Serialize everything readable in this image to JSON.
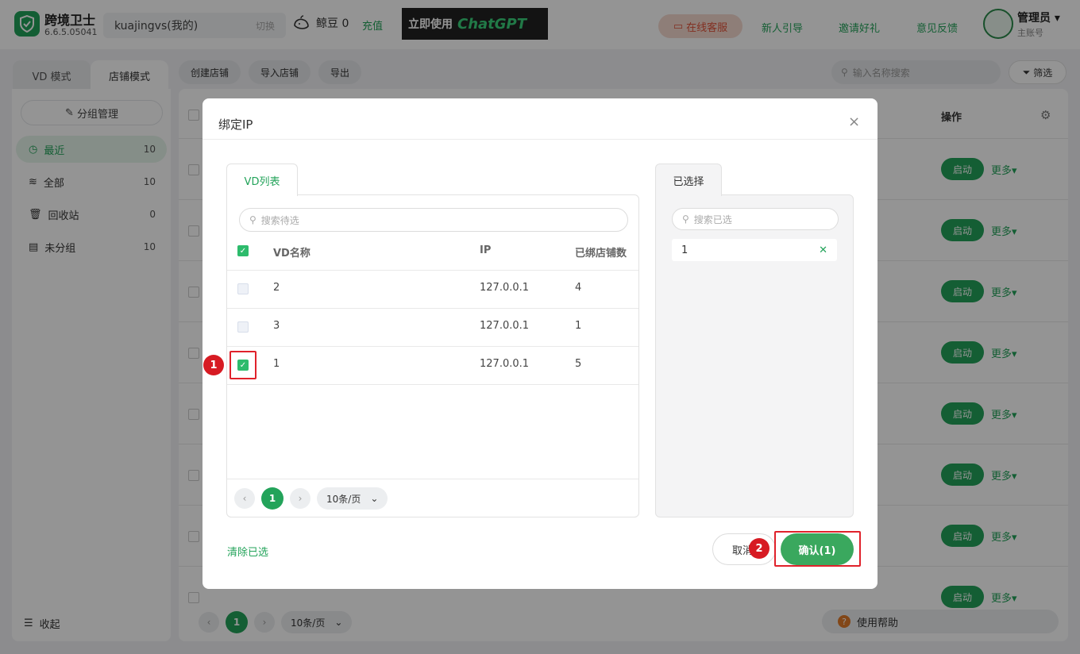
{
  "app": {
    "name": "跨境卫士",
    "version": "6.6.5.05041"
  },
  "topbar": {
    "account_name": "kuajingvs(我的)",
    "switch_label": "切换",
    "bean_label": "鲸豆 0",
    "recharge_label": "充值",
    "banner_text_1": "立即使用",
    "banner_text_2": "ChatGPT",
    "service_label": "在线客服",
    "links": [
      "新人引导",
      "邀请好礼",
      "意见反馈"
    ],
    "user_name": "管理员",
    "user_role": "主账号"
  },
  "sidebar": {
    "mode_tabs": [
      "VD 模式",
      "店铺模式"
    ],
    "active_mode": "店铺模式",
    "group_manage_label": "分组管理",
    "items": [
      {
        "label": "最近",
        "count": "10"
      },
      {
        "label": "全部",
        "count": "10"
      },
      {
        "label": "回收站",
        "count": "0"
      },
      {
        "label": "未分组",
        "count": "10"
      }
    ],
    "collapse_label": "收起"
  },
  "toolbar": {
    "create_label": "创建店铺",
    "import_label": "导入店铺",
    "export_label": "导出",
    "search_placeholder": "输入名称搜索",
    "filter_label": "筛选"
  },
  "table": {
    "op_header": "操作",
    "start_label": "启动",
    "more_label": "更多"
  },
  "bottom_pager": {
    "page": "1",
    "page_size": "10条/页"
  },
  "help_label": "使用帮助",
  "modal": {
    "title": "绑定IP",
    "left_tab": "VD列表",
    "left_search_placeholder": "搜索待选",
    "columns": [
      "VD名称",
      "IP",
      "已绑店铺数"
    ],
    "rows": [
      {
        "name": "2",
        "ip": "127.0.0.1",
        "count": "4",
        "checked": false
      },
      {
        "name": "3",
        "ip": "127.0.0.1",
        "count": "1",
        "checked": false
      },
      {
        "name": "1",
        "ip": "127.0.0.1",
        "count": "5",
        "checked": true
      }
    ],
    "pager": {
      "page": "1",
      "page_size": "10条/页"
    },
    "right_tab": "已选择",
    "right_search_placeholder": "搜索已选",
    "selected": [
      "1"
    ],
    "clear_label": "清除已选",
    "cancel_label": "取消",
    "confirm_label": "确认(1)"
  },
  "annotations": [
    "1",
    "2"
  ],
  "colors": {
    "accent": "#23a35a",
    "highlight": "#e0222b",
    "service": "#e0533a"
  }
}
